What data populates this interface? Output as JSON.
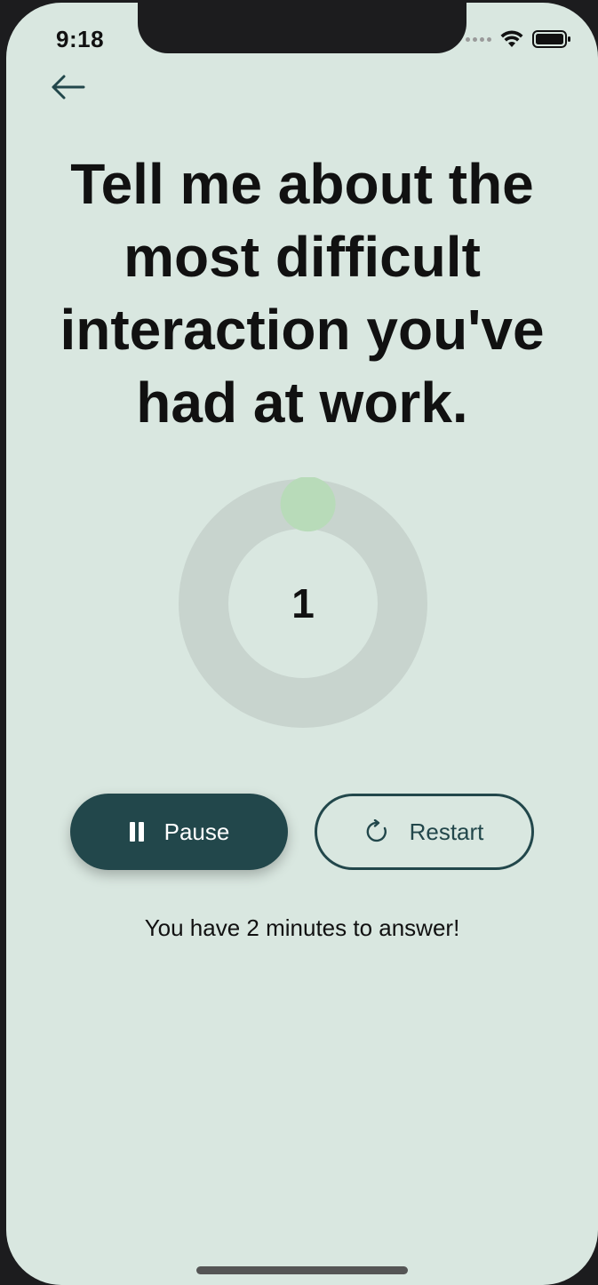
{
  "status_bar": {
    "time": "9:18",
    "signal_icon": "cellular-signal-icon",
    "wifi_icon": "wifi-icon",
    "battery_icon": "battery-icon"
  },
  "header": {
    "back_icon": "arrow-left-icon"
  },
  "question": {
    "text": "Tell me about the most difficult interaction you've had at work."
  },
  "timer": {
    "value": "1",
    "progress_fraction": 0.008
  },
  "controls": {
    "pause_label": "Pause",
    "pause_icon": "pause-icon",
    "restart_label": "Restart",
    "restart_icon": "restart-icon"
  },
  "hint": {
    "text": "You have 2 minutes to answer!"
  },
  "colors": {
    "background": "#d9e7e0",
    "accent": "#22474b",
    "ring_track": "#c8d4ce",
    "ring_progress": "#b8dbb9"
  }
}
